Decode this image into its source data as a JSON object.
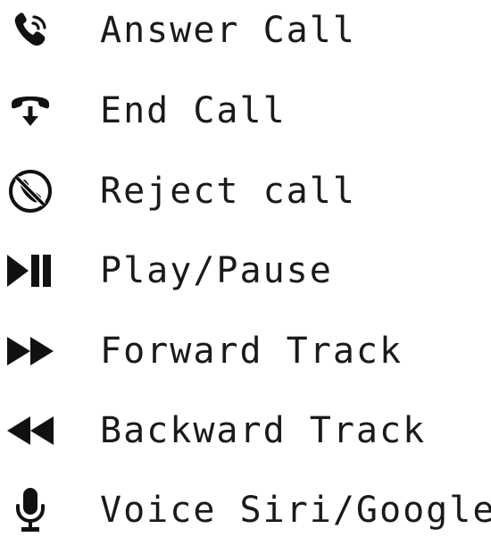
{
  "colors": {
    "icon": "#111111",
    "text": "#1a1a1a",
    "background": "#ffffff"
  },
  "items": [
    {
      "icon": "phone-answer-icon",
      "label": "Answer Call"
    },
    {
      "icon": "phone-hangup-icon",
      "label": "End Call"
    },
    {
      "icon": "phone-reject-icon",
      "label": "Reject call"
    },
    {
      "icon": "play-pause-icon",
      "label": "Play/Pause"
    },
    {
      "icon": "fast-forward-icon",
      "label": "Forward Track"
    },
    {
      "icon": "rewind-icon",
      "label": "Backward Track"
    },
    {
      "icon": "microphone-icon",
      "label": "Voice Siri/Google"
    }
  ]
}
